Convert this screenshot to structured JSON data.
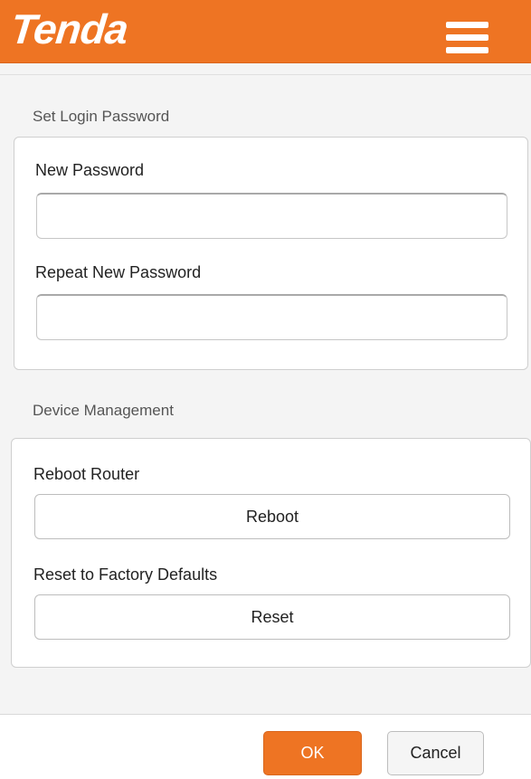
{
  "header": {
    "logo_text": "Tenda",
    "menu_icon": "hamburger-menu-icon",
    "accent_color": "#ee7423"
  },
  "login_password": {
    "section_title": "Set Login Password",
    "new_password": {
      "label": "New Password",
      "value": "",
      "placeholder": ""
    },
    "repeat_password": {
      "label": "Repeat New Password",
      "value": "",
      "placeholder": ""
    }
  },
  "device_management": {
    "section_title": "Device Management",
    "reboot": {
      "label": "Reboot Router",
      "button_label": "Reboot"
    },
    "reset": {
      "label": "Reset to Factory Defaults",
      "button_label": "Reset"
    }
  },
  "footer": {
    "ok_label": "OK",
    "cancel_label": "Cancel"
  }
}
